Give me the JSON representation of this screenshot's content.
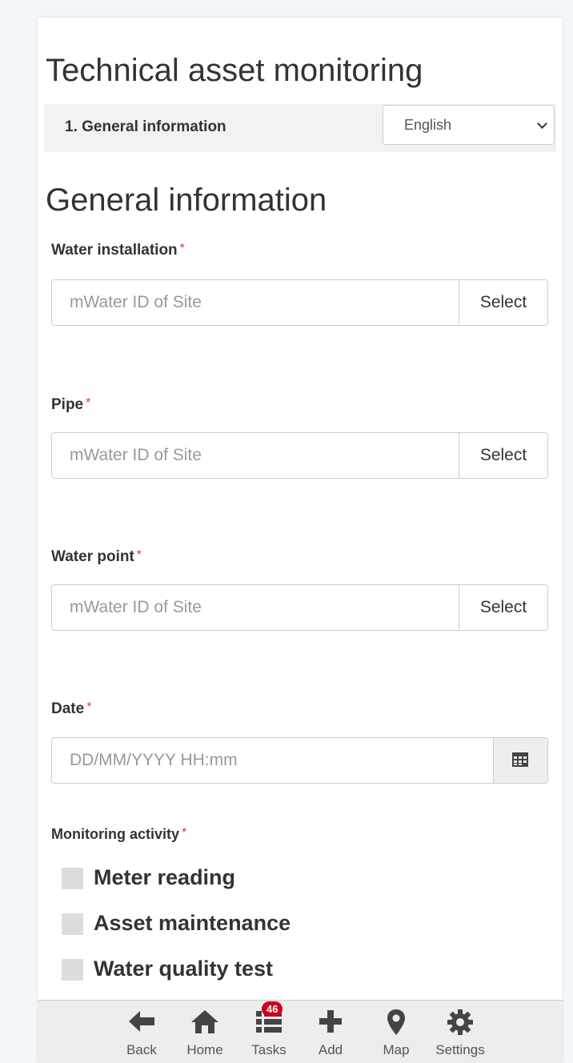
{
  "form": {
    "title": "Technical asset monitoring",
    "section_nav": "1. General information",
    "language": "English",
    "section_heading": "General information"
  },
  "questions": {
    "water_installation": {
      "label": "Water installation",
      "required": "*",
      "placeholder": "mWater ID of Site",
      "button": "Select"
    },
    "pipe": {
      "label": "Pipe",
      "required": "*",
      "placeholder": "mWater ID of Site",
      "button": "Select"
    },
    "water_point": {
      "label": "Water point",
      "required": "*",
      "placeholder": "mWater ID of Site",
      "button": "Select"
    },
    "date": {
      "label": "Date",
      "required": "*",
      "placeholder": "DD/MM/YYYY HH:mm",
      "icon": "calendar-icon"
    },
    "monitoring_activity": {
      "label": "Monitoring activity",
      "required": "*",
      "options": [
        "Meter reading",
        "Asset maintenance",
        "Water quality test"
      ]
    }
  },
  "bottom_nav": {
    "items": [
      {
        "label": "Back",
        "icon": "arrow-left-icon"
      },
      {
        "label": "Home",
        "icon": "home-icon"
      },
      {
        "label": "Tasks",
        "icon": "tasks-icon",
        "badge": "46"
      },
      {
        "label": "Add",
        "icon": "plus-icon"
      },
      {
        "label": "Map",
        "icon": "map-pin-icon"
      },
      {
        "label": "Settings",
        "icon": "gear-icon"
      }
    ]
  },
  "colors": {
    "required": "#e03b3b",
    "badge": "#d0021b",
    "page_bg": "#f3f7fc"
  }
}
